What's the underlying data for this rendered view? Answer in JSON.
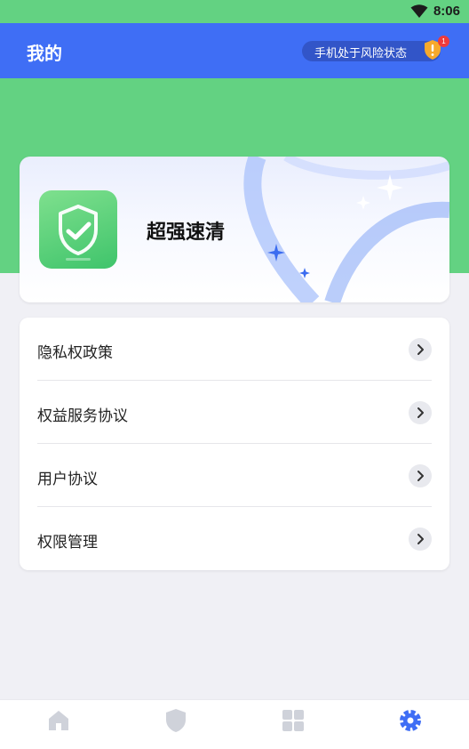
{
  "status_bar": {
    "time": "8:06",
    "wifi_icon": "wifi-icon"
  },
  "header": {
    "title": "我的",
    "risk_label": "手机处于风险状态",
    "risk_badge": "1",
    "risk_icon": "warning-shield-icon"
  },
  "hero": {
    "app_name": "超强速清",
    "logo_icon": "shield-check-icon"
  },
  "menu": {
    "items": [
      {
        "label": "隐私权政策",
        "icon": "chevron-right-icon"
      },
      {
        "label": "权益服务协议",
        "icon": "chevron-right-icon"
      },
      {
        "label": "用户协议",
        "icon": "chevron-right-icon"
      },
      {
        "label": "权限管理",
        "icon": "chevron-right-icon"
      }
    ]
  },
  "tab_bar": {
    "tabs": [
      {
        "icon": "home-icon",
        "active": false
      },
      {
        "icon": "shield-icon",
        "active": false
      },
      {
        "icon": "grid-icon",
        "active": false
      },
      {
        "icon": "gear-icon",
        "active": true
      }
    ]
  },
  "colors": {
    "primary_blue": "#3f6ef5",
    "brand_green": "#63d282",
    "active_tab": "#3f6ef5",
    "inactive_tab": "#cfd2da",
    "badge_red": "#ef3b3b"
  }
}
